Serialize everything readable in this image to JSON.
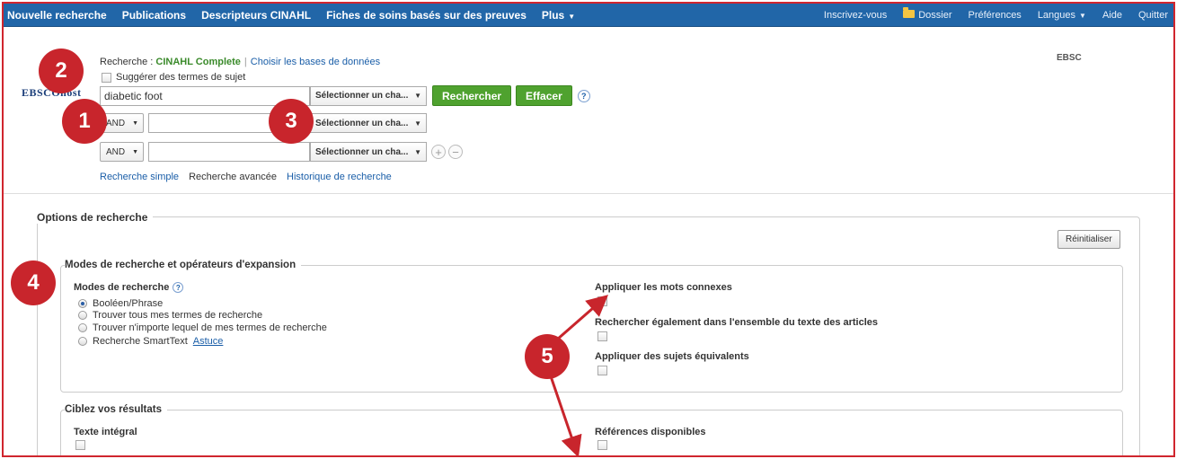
{
  "topnav": {
    "left": [
      "Nouvelle recherche",
      "Publications",
      "Descripteurs CINAHL",
      "Fiches de soins basés sur des preuves",
      "Plus"
    ],
    "right": [
      "Inscrivez-vous",
      "Dossier",
      "Préférences",
      "Langues",
      "Aide",
      "Quitter"
    ]
  },
  "brand": {
    "logo": "EBSCOhost",
    "right": "EBSC"
  },
  "search": {
    "label": "Recherche : ",
    "database": "CINAHL Complete",
    "choose_db": "Choisir les bases de données",
    "suggest": "Suggérer des termes de sujet",
    "rows": [
      {
        "bool": "",
        "term": "diabetic foot",
        "field": "Sélectionner un cha..."
      },
      {
        "bool": "AND",
        "term": "",
        "field": "Sélectionner un cha..."
      },
      {
        "bool": "AND",
        "term": "",
        "field": "Sélectionner un cha..."
      }
    ],
    "search_btn": "Rechercher",
    "clear_btn": "Effacer",
    "help": "?",
    "links": [
      "Recherche simple",
      "Recherche avancée",
      "Historique de recherche"
    ]
  },
  "options": {
    "title": "Options de recherche",
    "reset": "Réinitialiser",
    "modes_title": "Modes de recherche et opérateurs d'expansion",
    "modes_label": "Modes de recherche",
    "modes": [
      "Booléen/Phrase",
      "Trouver tous mes termes de recherche",
      "Trouver n'importe lequel de mes termes de recherche",
      "Recherche SmartText"
    ],
    "tip": "Astuce",
    "expanders": [
      "Appliquer les mots connexes",
      "Rechercher également dans l'ensemble du texte des articles",
      "Appliquer des sujets équivalents"
    ],
    "limit_title": "Ciblez vos résultats",
    "limiters": [
      "Texte intégral",
      "Références disponibles"
    ]
  },
  "badges": [
    "1",
    "2",
    "3",
    "4",
    "5"
  ],
  "colors": {
    "nav": "#2166a8",
    "green": "#4fa22f",
    "badge": "#c8252c",
    "link": "#1a5ea8"
  }
}
